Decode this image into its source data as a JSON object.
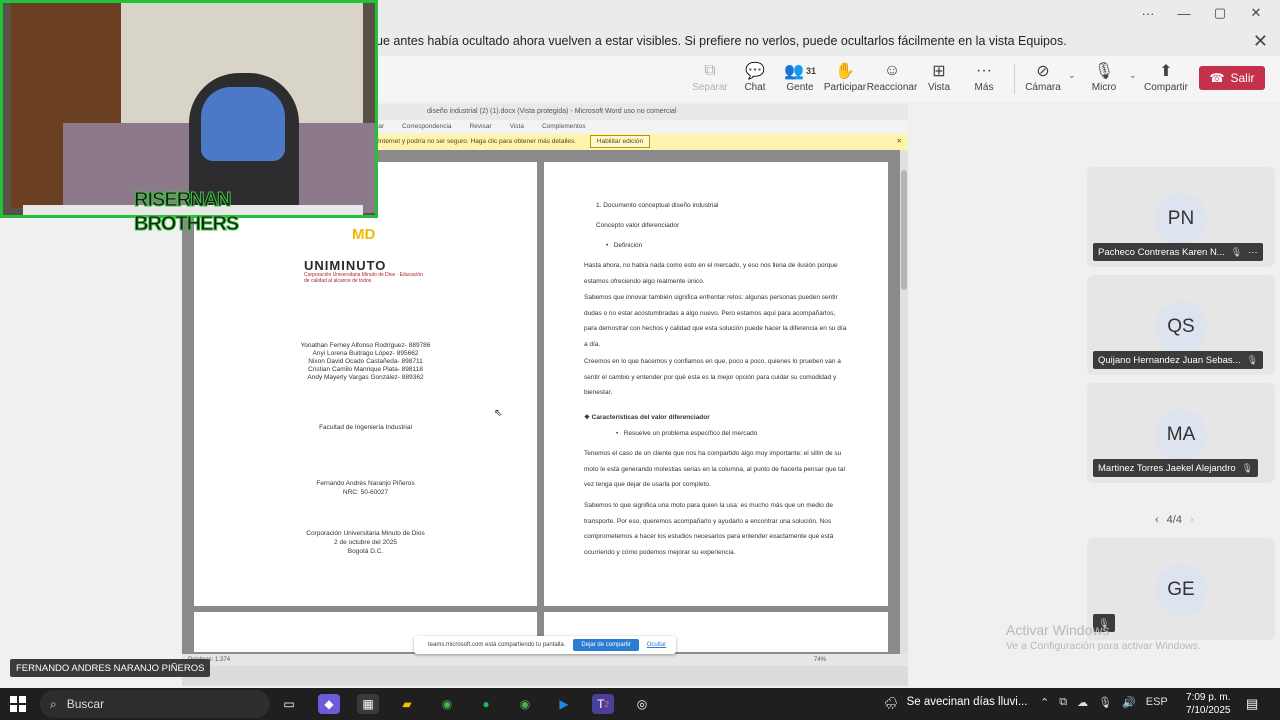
{
  "banner": {
    "text": "ue antes había ocultado ahora vuelven a estar visibles. Si prefiere no verlos, puede ocultarlos fácilmente en la vista Equipos."
  },
  "toolbar": {
    "items": [
      {
        "label": "Separar",
        "icon": "pop-out-icon"
      },
      {
        "label": "Chat",
        "icon": "chat-icon"
      },
      {
        "label": "Gente",
        "icon": "people-icon",
        "count": "31"
      },
      {
        "label": "Participar",
        "icon": "raise-hand-icon"
      },
      {
        "label": "Reaccionar",
        "icon": "emoji-icon"
      },
      {
        "label": "Vista",
        "icon": "grid-view-icon"
      },
      {
        "label": "Más",
        "icon": "more-icon"
      },
      {
        "label": "Cámara",
        "icon": "camera-off-icon"
      },
      {
        "label": "Micro",
        "icon": "mic-off-icon"
      },
      {
        "label": "Compartir",
        "icon": "share-icon"
      }
    ],
    "leave_label": "Salir"
  },
  "word": {
    "title": "diseño industrial (2) (1).docx (Vista protegida) - Microsoft Word uso no comercial",
    "menu": [
      "Insertar",
      "Correspondencia",
      "Revisar",
      "Vista",
      "Complementos"
    ],
    "protected_bar": "Internet y podría no ser seguro. Haga clic para obtener más detalles.",
    "enable_label": "Habilitar edición",
    "status": "Palabras: 1.374",
    "zoom": "74%"
  },
  "page1": {
    "logo_md": "MD",
    "logo_name": "UNIMINUTO",
    "logo_sub": "Corporación Universitaria Minuto de Dios · Educación de calidad al alcance de todos",
    "authors": [
      "Yonathan Ferney Alfonso Rodríguez- 889786",
      "Anyi Lorena Buitrago López- 895662",
      "Nixon David Ocado Castañeda- 898711",
      "Cristian Camilo Manrique Plata- 898118",
      "Andy Mayerly Vargas González- 889362"
    ],
    "faculty": "Facultad de Ingeniería Industrial",
    "teacher": "Fernando Andrés Naranjo Piñeros",
    "nrc": "NRC: 50-60027",
    "institution": "Corporación Universitaria Minuto de Dios",
    "date": "2 de octubre del 2025",
    "city": "Bogotá D.C."
  },
  "page2": {
    "heading1": "1.    Documento conceptual diseño industrial",
    "heading2": "Concepto valor diferenciador",
    "bullet1": "Definición",
    "para1": "Hasta ahora, no había nada como esto en el mercado, y eso nos llena de ilusión porque estamos ofreciendo algo realmente único.",
    "para2": "Sabemos que innovar también significa enfrentar retos: algunas personas pueden sentir dudas o no estar acostumbradas a algo nuevo. Pero estamos aquí para acompañarlos, para demostrar con hechos y calidad que esta solución puede hacer la diferencia en su día a día.",
    "para3": "Creemos en lo que hacemos y confiamos en que, poco a poco, quienes lo prueben van a sentir el cambio y entender por qué esta es la mejor opción para cuidar su comodidad y bienestar.",
    "heading3": "Características del valor diferenciador",
    "bullet2": "Resuelve un problema específico del mercado",
    "para4": "Tenemos el caso de un cliente que nos ha compartido algo muy importante: el sillín de su moto le está generando molestias serias en la columna, al punto de hacerla pensar que tal vez tenga que dejar de usarla por completo.",
    "para5": "Sabemos lo que significa una moto para quien la usa: es mucho más que un medio de transporte. Por eso, queremos acompañarlo y ayudarlo a encontrar una solución. Nos comprometemos a hacer los estudios necesarios para entender exactamente qué está ocurriendo y cómo podemos mejorar su experiencia."
  },
  "share_pill": {
    "text": "teams.microsoft.com está compartiendo tu pantalla.",
    "stop_label": "Dejar de compartir",
    "hide_label": "Ocultar"
  },
  "webcam": {
    "overlay_text": "RISERNAN BROTHERS"
  },
  "participants": [
    {
      "initials": "PN",
      "name": "Pacheco Contreras Karen N...",
      "more": "···"
    },
    {
      "initials": "QS",
      "name": "Quijano Hernandez Juan Sebas..."
    },
    {
      "initials": "MA",
      "name": "Martinez Torres Jaekel Alejandro"
    },
    {
      "initials": "GE",
      "name": ""
    }
  ],
  "pager": {
    "text": "4/4"
  },
  "presenter_name": "FERNANDO ANDRES NARANJO PIÑEROS",
  "activate": {
    "line1": "Activar Windows",
    "line2": "Ve a Configuración para activar Windows."
  },
  "taskbar": {
    "search_label": "Buscar",
    "weather": "Se avecinan días lluvi...",
    "lang": "ESP",
    "time": "7:09 p. m.",
    "date": "7/10/2025",
    "teams_badge": "2"
  }
}
